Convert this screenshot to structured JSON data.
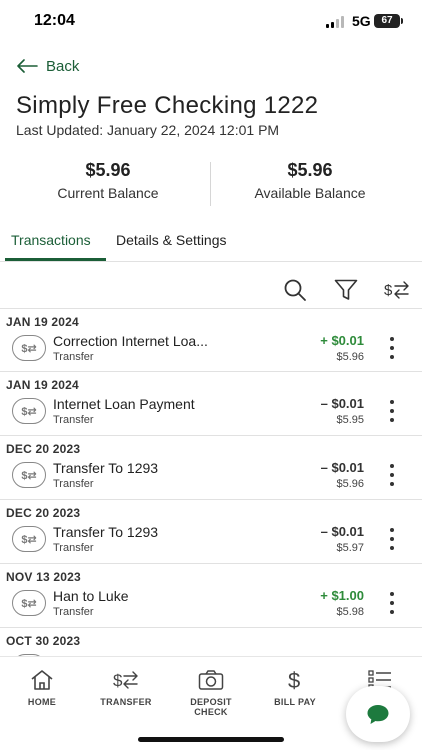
{
  "status": {
    "time": "12:04",
    "network": "5G",
    "battery": "67"
  },
  "nav": {
    "back_label": "Back"
  },
  "account": {
    "title": "Simply Free Checking 1222",
    "last_updated": "Last Updated: January 22, 2024 12:01 PM"
  },
  "balances": {
    "current": {
      "amount": "$5.96",
      "label": "Current Balance"
    },
    "available": {
      "amount": "$5.96",
      "label": "Available Balance"
    }
  },
  "tabs": [
    {
      "label": "Transactions",
      "active": true
    },
    {
      "label": "Details & Settings",
      "active": false
    }
  ],
  "tools": {
    "search": "search-icon",
    "filter": "filter-icon",
    "transfer": "transfer-icon"
  },
  "transactions": [
    {
      "date": "JAN 19 2024",
      "description": "Correction Internet Loa...",
      "type": "Transfer",
      "amount": "+ $0.01",
      "balance": "$5.96",
      "credit": true
    },
    {
      "date": "JAN 19 2024",
      "description": "Internet Loan Payment",
      "type": "Transfer",
      "amount": "– $0.01",
      "balance": "$5.95",
      "credit": false
    },
    {
      "date": "DEC 20 2023",
      "description": "Transfer To 1293",
      "type": "Transfer",
      "amount": "– $0.01",
      "balance": "$5.96",
      "credit": false
    },
    {
      "date": "DEC 20 2023",
      "description": "Transfer To 1293",
      "type": "Transfer",
      "amount": "– $0.01",
      "balance": "$5.97",
      "credit": false
    },
    {
      "date": "NOV 13 2023",
      "description": "Han to Luke",
      "type": "Transfer",
      "amount": "+ $1.00",
      "balance": "$5.98",
      "credit": true
    },
    {
      "date": "OCT 30 2023",
      "description": "",
      "type": "",
      "amount": "",
      "balance": "",
      "credit": false
    }
  ],
  "txn_icon_glyph": "$⇄",
  "tabbar": [
    {
      "label": "HOME",
      "icon": "home-icon"
    },
    {
      "label": "TRANSFER",
      "icon": "transfer-icon"
    },
    {
      "label": "DEPOSIT CHECK",
      "icon": "camera-icon"
    },
    {
      "label": "BILL PAY",
      "icon": "dollar-icon"
    },
    {
      "label": "",
      "icon": "menu-list-icon"
    }
  ],
  "colors": {
    "brand_green": "#1b5e37",
    "credit_green": "#2e8b3a",
    "chat_green": "#1d7a3e"
  }
}
